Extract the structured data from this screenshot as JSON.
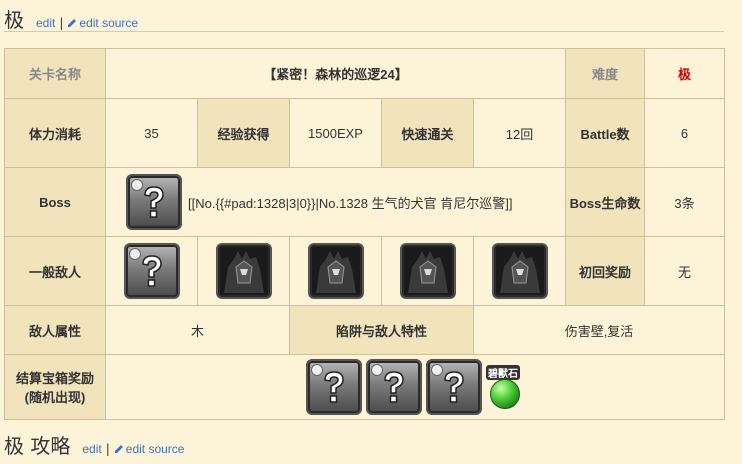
{
  "top_header": {
    "title": "极",
    "edit_label": "edit",
    "separator": "|",
    "edit_source_label": "edit source"
  },
  "bottom_header": {
    "title": "极 攻略",
    "edit_label": "edit",
    "separator": "|",
    "edit_source_label": "edit source"
  },
  "stage": {
    "name_label": "关卡名称",
    "name_value": "【紧密！森林的巡逻24】",
    "difficulty_label": "难度",
    "difficulty_value": "极",
    "stamina_label": "体力消耗",
    "stamina_value": "35",
    "exp_label": "经验获得",
    "exp_value": "1500EXP",
    "fast_clear_label": "快速通关",
    "fast_clear_value": "12回",
    "battle_label": "Battle数",
    "battle_value": "6",
    "boss_label": "Boss",
    "boss_text": "[[No.{{#pad:1328|3|0}}|No.1328 生气的犬官 肯尼尔巡警]]",
    "boss_life_label": "Boss生命数",
    "boss_life_value": "3条",
    "enemy_label": "一般敌人",
    "first_reward_label": "初回奖励",
    "first_reward_value": "无",
    "enemy_attr_label": "敌人属性",
    "enemy_attr_value": "木",
    "trap_label": "陷阱与敌人特性",
    "trap_value": "伤害壁,复活",
    "chest_label_line1": "结算宝箱奖励",
    "chest_label_line2": "(随机出现)",
    "gem_label": "碧獸石"
  },
  "icons": {
    "unknown": "question-mark-monster-icon",
    "dark_monster": "dark-knight-monster-icon",
    "gem": "green-gem-icon",
    "pencil": "pencil-icon"
  },
  "colors": {
    "background": "#fdf3d8",
    "label_cell": "#f1e3bc",
    "difficulty": "#d40000",
    "link": "#3b73c6"
  }
}
